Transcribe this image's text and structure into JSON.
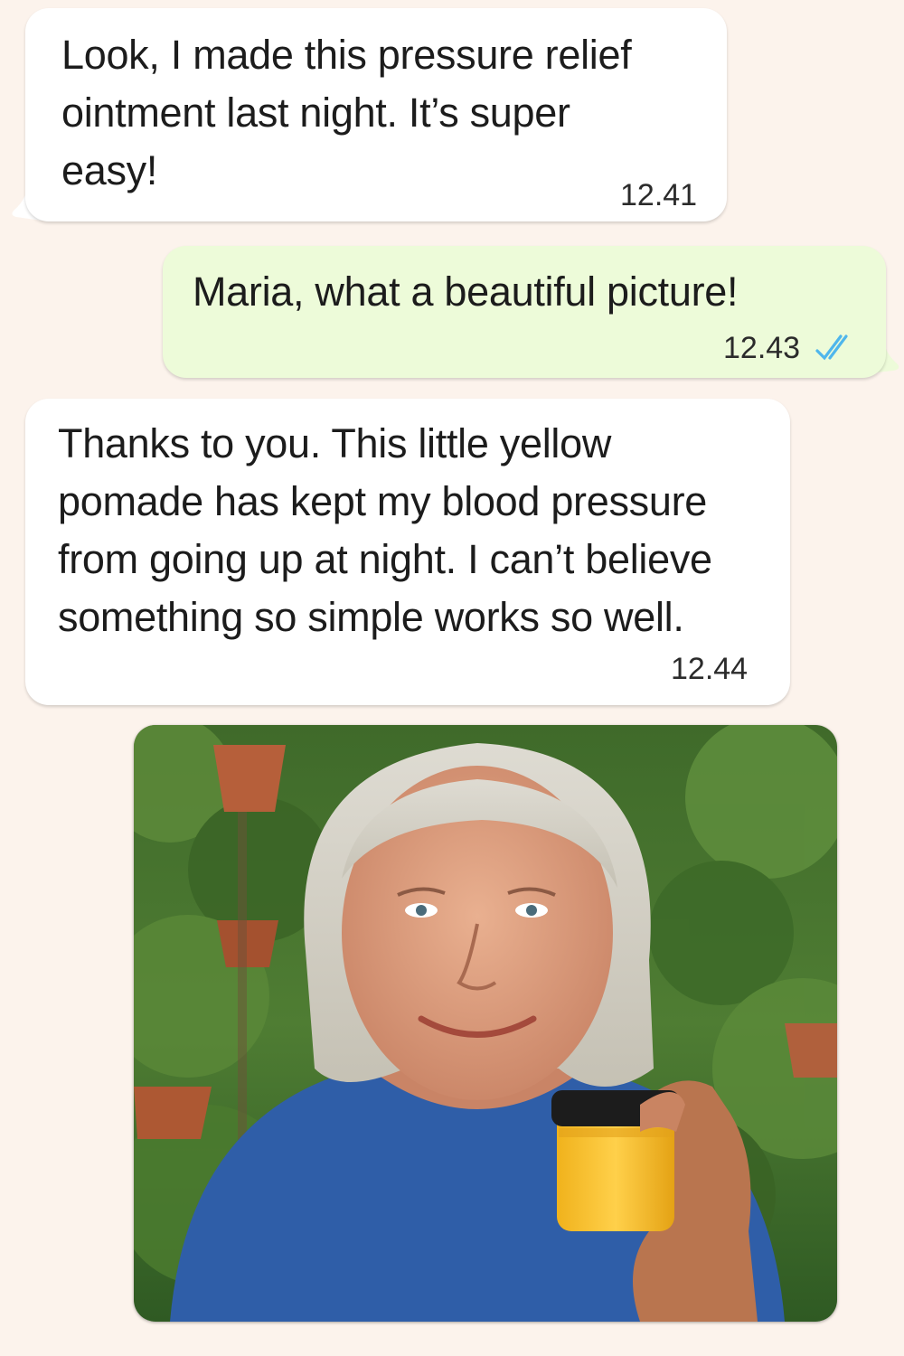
{
  "messages": [
    {
      "direction": "incoming",
      "text": "Look, I made this pressure relief\nointment last night. It’s super\neasy!",
      "time": "12.41"
    },
    {
      "direction": "outgoing",
      "text": "Maria, what a beautiful picture!",
      "time": "12.43",
      "status": "read-double-check-icon"
    },
    {
      "direction": "incoming",
      "text": "Thanks to you. This little yellow\npomade has kept my blood pressure\nfrom going up at night. I can’t believe\nsomething so simple works so well.",
      "time": "12.44"
    }
  ],
  "photo": {
    "type": "image-message"
  },
  "colors": {
    "background": "#fcf3ec",
    "incoming_bubble": "#ffffff",
    "outgoing_bubble": "#edfbd9",
    "read_check": "#4fb6ec"
  }
}
